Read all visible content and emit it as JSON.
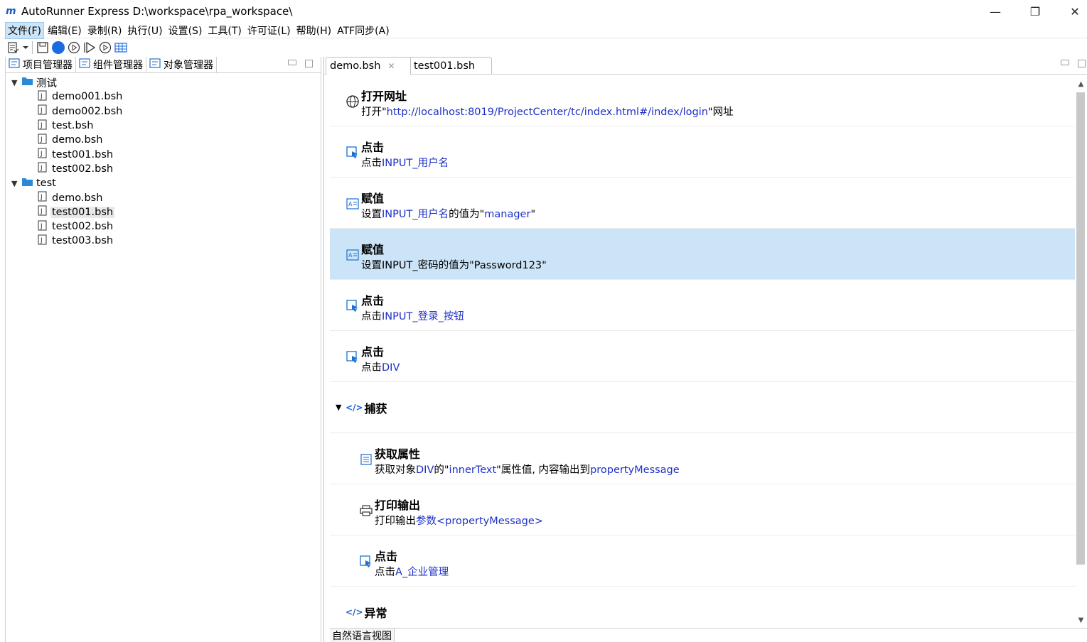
{
  "window": {
    "app_name": "AutoRunner Express",
    "workspace_path": "D:\\workspace\\rpa_workspace\\",
    "minimize_glyph": "—",
    "restore_glyph": "❐",
    "close_glyph": "✕"
  },
  "menu": [
    {
      "label": "文件(F)"
    },
    {
      "label": "编辑(E)"
    },
    {
      "label": "录制(R)"
    },
    {
      "label": "执行(U)"
    },
    {
      "label": "设置(S)"
    },
    {
      "label": "工具(T)"
    },
    {
      "label": "许可证(L)"
    },
    {
      "label": "帮助(H)"
    },
    {
      "label": "ATF同步(A)"
    }
  ],
  "left_panel": {
    "tabs": [
      {
        "label": "项目管理器"
      },
      {
        "label": "组件管理器"
      },
      {
        "label": "对象管理器"
      }
    ],
    "tree": {
      "folders": [
        {
          "name": "测试",
          "files": [
            "demo001.bsh",
            "demo002.bsh",
            "test.bsh",
            "demo.bsh",
            "test001.bsh",
            "test002.bsh"
          ]
        },
        {
          "name": "test",
          "files": [
            "demo.bsh",
            "test001.bsh",
            "test002.bsh",
            "test003.bsh"
          ]
        }
      ]
    }
  },
  "editor": {
    "tabs": [
      {
        "label": "demo.bsh",
        "close": "✕"
      },
      {
        "label": "test001.bsh"
      }
    ],
    "steps": [
      {
        "title": "打开网址",
        "desc_prefix": "打开\"",
        "desc_value": "http://localhost:8019/ProjectCenter/tc/index.html#/index/login",
        "desc_suffix": "\"网址",
        "icon": "globe-icon"
      },
      {
        "title": "点击",
        "desc_prefix": "点击",
        "desc_value": "INPUT_用户名",
        "desc_suffix": "",
        "icon": "click-icon"
      },
      {
        "title": "赋值",
        "desc_prefix": "设置",
        "desc_value": "INPUT_用户名",
        "desc_mid": "的值为\"",
        "desc_value2": "manager",
        "desc_suffix": "\"",
        "icon": "assign-icon"
      },
      {
        "title": "赋值",
        "desc_full": "设置INPUT_密码的值为\"Password123\"",
        "icon": "assign-icon"
      },
      {
        "title": "点击",
        "desc_prefix": "点击",
        "desc_value": "INPUT_登录_按钮",
        "desc_suffix": "",
        "icon": "click-icon"
      },
      {
        "title": "点击",
        "desc_prefix": "点击",
        "desc_value": "DIV",
        "desc_suffix": "",
        "icon": "click-icon"
      }
    ],
    "capture_group": {
      "title": "捕获",
      "icon_glyph": "</>"
    },
    "capture_steps": [
      {
        "title": "获取属性",
        "desc_prefix": "获取对象",
        "desc_value": "DIV",
        "desc_mid": "的\"",
        "desc_value2": "innerText",
        "desc_mid2": "\"属性值, 内容输出到",
        "desc_value3": "propertyMessage",
        "icon": "list-icon"
      },
      {
        "title": "打印输出",
        "desc_prefix": "打印输出",
        "desc_value": "参数<propertyMessage>",
        "icon": "print-icon"
      },
      {
        "title": "点击",
        "desc_prefix": "点击",
        "desc_value": "A_企业管理",
        "icon": "click-icon"
      }
    ],
    "exception_group": {
      "title": "异常",
      "icon_glyph": "</>"
    },
    "bottom_tab": "自然语言视图"
  },
  "colors": {
    "selected_row": "#cce4f7",
    "link_blue": "#1c30c8",
    "folder_blue": "#2a8ad8"
  }
}
